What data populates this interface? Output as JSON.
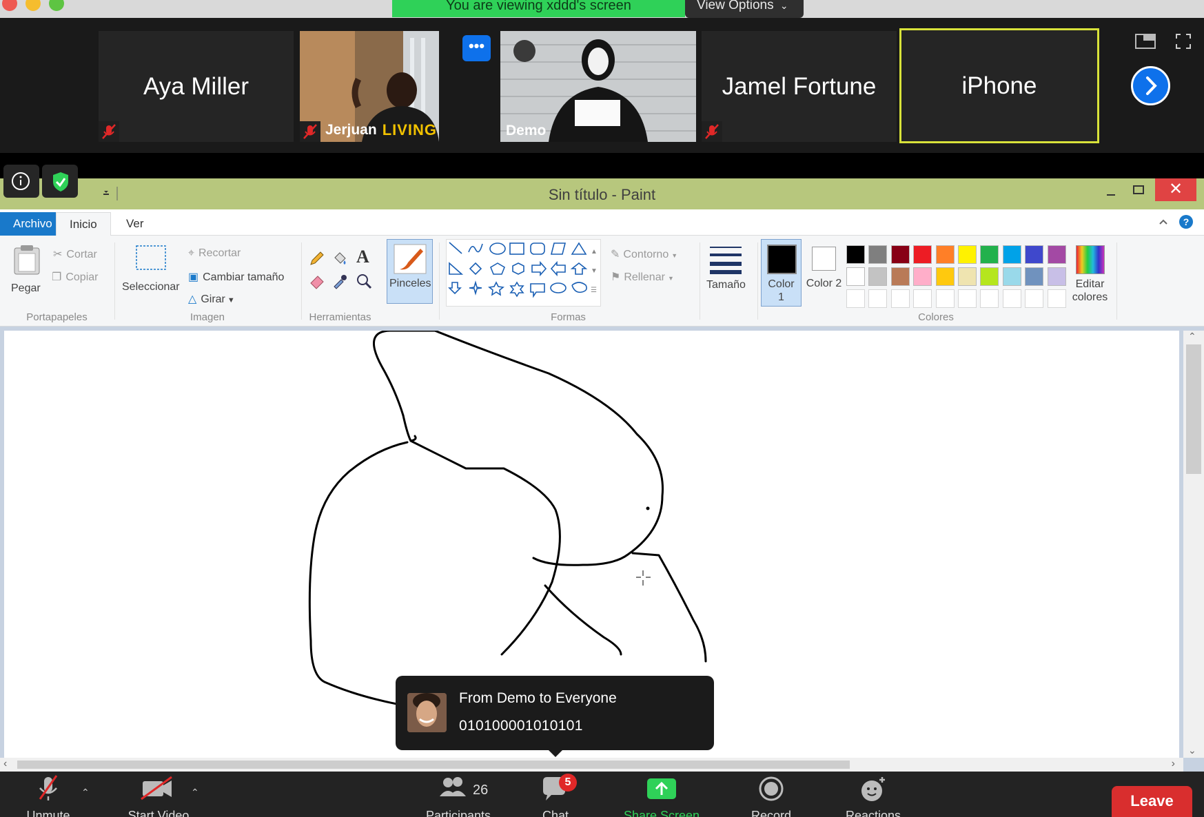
{
  "screen_share": {
    "banner": "You are viewing xddd's screen",
    "view_options": "View Options"
  },
  "participants": [
    {
      "name": "Aya Miller"
    },
    {
      "name": "Jerjuan"
    },
    {
      "name": "Demo"
    },
    {
      "name": "Jamel Fortune"
    },
    {
      "name": "iPhone"
    }
  ],
  "jerjuan_shirt_text": "LIVING",
  "paint": {
    "title": "Sin título - Paint",
    "tabs": [
      "Archivo",
      "Inicio",
      "Ver"
    ],
    "clipboard": {
      "paste": "Pegar",
      "cut": "Cortar",
      "copy": "Copiar",
      "group": "Portapapeles"
    },
    "image": {
      "select": "Seleccionar",
      "crop": "Recortar",
      "resize": "Cambiar tamaño",
      "rotate": "Girar",
      "group": "Imagen"
    },
    "tools": {
      "group": "Herramientas"
    },
    "brushes": "Pinceles",
    "shapes": {
      "outline": "Contorno",
      "fill": "Rellenar",
      "group": "Formas"
    },
    "size": "Tamaño",
    "color1": "Color 1",
    "color2": "Color 2",
    "edit_colors": "Editar colores",
    "colors_group": "Colores",
    "palette_row1": [
      "#000000",
      "#7f7f7f",
      "#880015",
      "#ed1c24",
      "#ff7f27",
      "#fff200",
      "#22b14c",
      "#00a2e8",
      "#3f48cc",
      "#a349a4"
    ],
    "palette_row2": [
      "#ffffff",
      "#c3c3c3",
      "#b97a57",
      "#ffaec9",
      "#ffc90e",
      "#efe4b0",
      "#b5e61d",
      "#99d9ea",
      "#7092be",
      "#c8bfe7"
    ]
  },
  "chat_toast": {
    "title": "From Demo to Everyone",
    "message": "010100001010101"
  },
  "toolbar": {
    "unmute": "Unmute",
    "start_video": "Start Video",
    "participants_count": "26",
    "participants": "Participants",
    "chat": "Chat",
    "chat_badge": "5",
    "share_screen": "Share Screen",
    "record": "Record",
    "reactions": "Reactions",
    "leave": "Leave"
  }
}
